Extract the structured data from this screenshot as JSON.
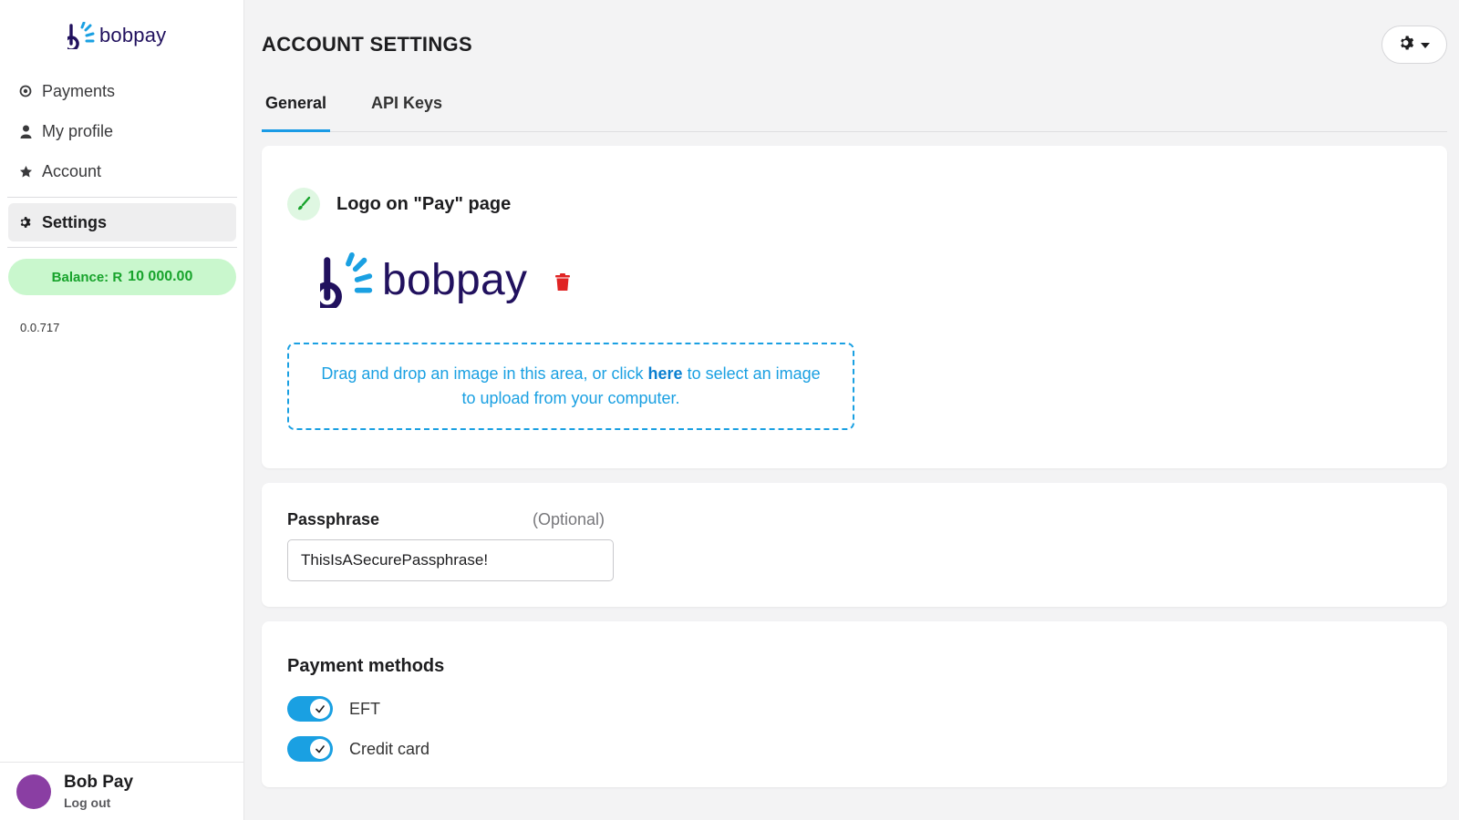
{
  "sidebar": {
    "brand": "bobpay",
    "nav": [
      {
        "label": "Payments",
        "icon": "target-icon"
      },
      {
        "label": "My profile",
        "icon": "user-icon"
      },
      {
        "label": "Account",
        "icon": "star-icon"
      },
      {
        "label": "Settings",
        "icon": "gear-icon"
      }
    ],
    "balance_label": "Balance: R",
    "balance_amount": "10 000.00",
    "version": "0.0.717",
    "user": {
      "name": "Bob Pay",
      "logout": "Log out"
    }
  },
  "header": {
    "title": "ACCOUNT SETTINGS",
    "settings_menu_icon": "gear-dropdown-icon"
  },
  "tabs": [
    {
      "label": "General",
      "active": true
    },
    {
      "label": "API Keys",
      "active": false
    }
  ],
  "logo_section": {
    "title": "Logo on \"Pay\" page",
    "logo_text": "bobpay",
    "dropzone_before": "Drag and drop an image in this area, or click ",
    "dropzone_link": "here",
    "dropzone_after": " to select an image to upload from your computer."
  },
  "passphrase": {
    "label": "Passphrase",
    "optional": "(Optional)",
    "value": "ThisIsASecurePassphrase!"
  },
  "payment_methods": {
    "title": "Payment methods",
    "items": [
      {
        "label": "EFT",
        "enabled": true
      },
      {
        "label": "Credit card",
        "enabled": true
      }
    ]
  },
  "colors": {
    "accent": "#1aa0e2",
    "brand_navy": "#21115e",
    "balance_bg": "#c9f7cd",
    "balance_text": "#17a32b",
    "delete_red": "#e02424"
  }
}
